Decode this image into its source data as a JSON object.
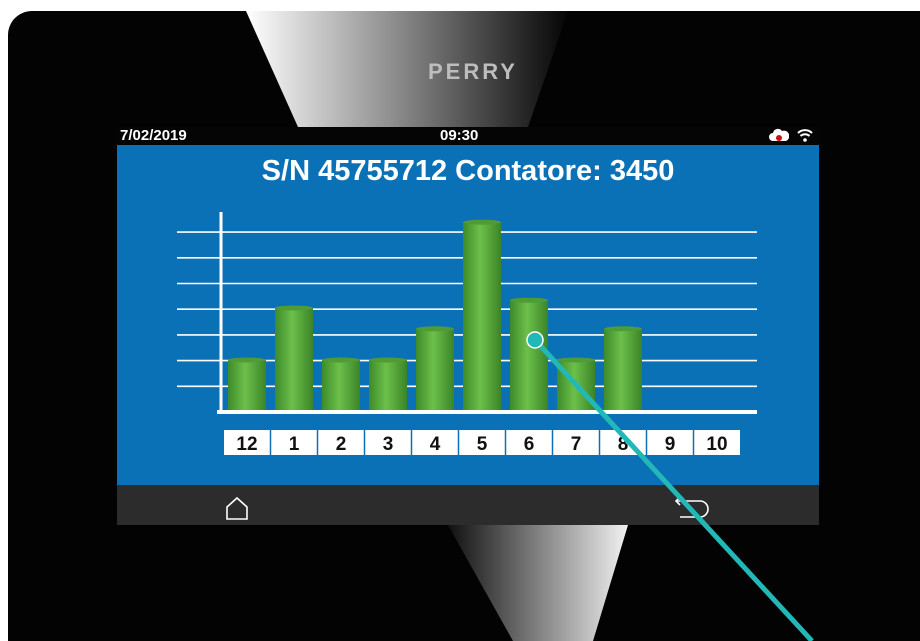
{
  "device": {
    "brand": "PERRY"
  },
  "status_bar": {
    "date": "7/02/2019",
    "time": "09:30",
    "icons": [
      "cloud-alert-icon",
      "wifi-icon"
    ]
  },
  "headline": "S/N 45755712 Contatore: 3450",
  "chart_data": {
    "type": "bar",
    "categories": [
      "12",
      "1",
      "2",
      "3",
      "4",
      "5",
      "6",
      "7",
      "8",
      "9",
      "10"
    ],
    "values": [
      2,
      4,
      2,
      2,
      3.2,
      7.3,
      4.3,
      2,
      3.2,
      0,
      0
    ],
    "ylim": [
      0,
      8
    ],
    "grid": true,
    "bar_color": "#5aac3e"
  },
  "nav": {
    "home_icon": "home-icon",
    "back_icon": "back-icon"
  },
  "annotation": {
    "color": "#22b8b8",
    "icon": "callout-pointer"
  }
}
